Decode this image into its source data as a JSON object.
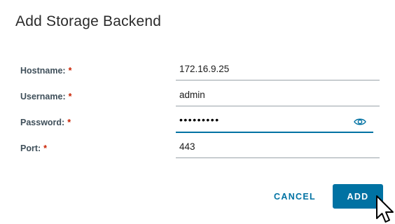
{
  "dialog": {
    "title": "Add Storage Backend"
  },
  "form": {
    "fields": [
      {
        "label": "Hostname:",
        "required_mark": "*",
        "value": "172.16.9.25"
      },
      {
        "label": "Username:",
        "required_mark": "*",
        "value": "admin"
      },
      {
        "label": "Password:",
        "required_mark": "*",
        "value": "•••••••••"
      },
      {
        "label": "Port:",
        "required_mark": "*",
        "value": "443"
      }
    ],
    "password_toggle_icon": "eye-icon"
  },
  "buttons": {
    "cancel_label": "CANCEL",
    "add_label": "ADD"
  },
  "colors": {
    "accent": "#0072a3",
    "required": "#c92100",
    "label": "#3f4f5a"
  }
}
